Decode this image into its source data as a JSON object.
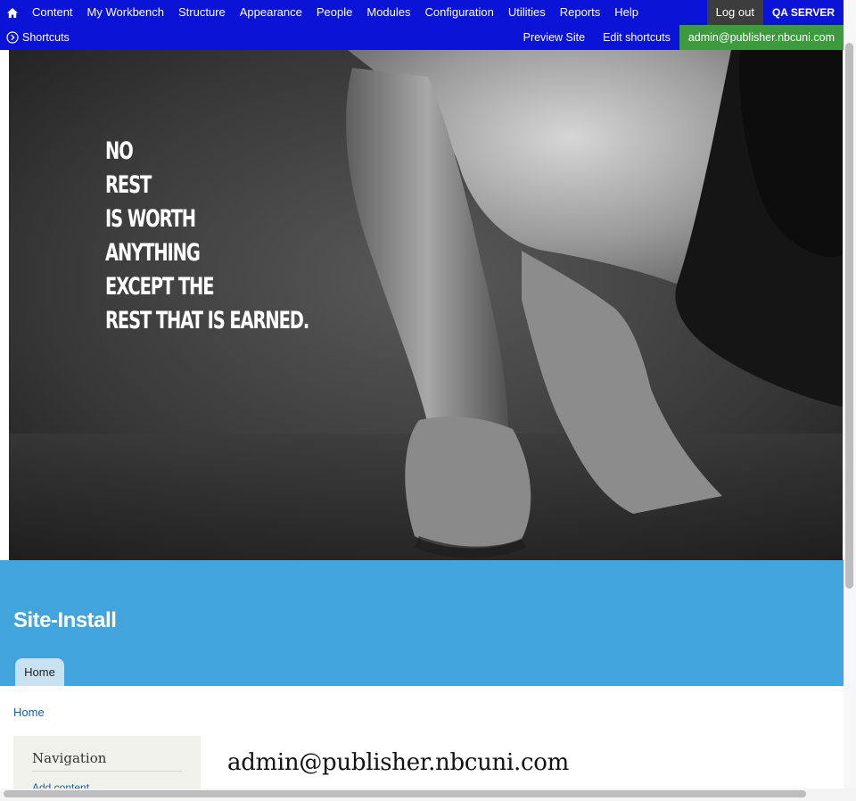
{
  "toolbar": {
    "menu": [
      "Content",
      "My Workbench",
      "Structure",
      "Appearance",
      "People",
      "Modules",
      "Configuration",
      "Utilities",
      "Reports",
      "Help"
    ],
    "logout": "Log out",
    "server": "QA SERVER",
    "shortcuts": "Shortcuts",
    "preview_site": "Preview Site",
    "edit_shortcuts": "Edit shortcuts",
    "user": "admin@publisher.nbcuni.com",
    "home_icon": "home-icon",
    "shortcuts_icon": "circle-chevron-right-icon"
  },
  "banner": {
    "quote_lines": [
      "No",
      "rest",
      "is worth",
      "anything",
      "except the",
      "rest that is earned."
    ]
  },
  "site": {
    "name": "Site-Install",
    "tab_home": "Home"
  },
  "main": {
    "breadcrumb": "Home",
    "sidebar_title": "Navigation",
    "sidebar_link": "Add content",
    "page_title": "admin@publisher.nbcuni.com"
  },
  "colors": {
    "toolbar": "#0b14d6",
    "logout_bg": "#3d3d3d",
    "user_badge": "#3d9b3d",
    "header_band": "#42a4dd",
    "tab": "#c9e2f2",
    "link": "#1a5da6"
  }
}
